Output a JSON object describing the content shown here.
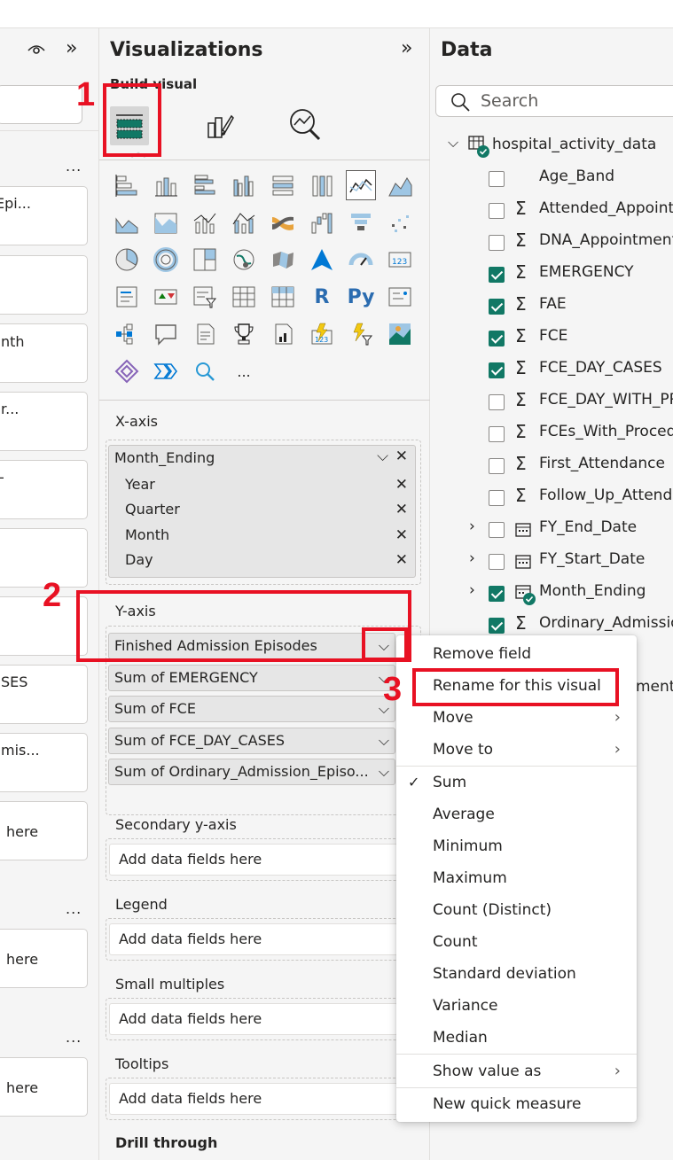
{
  "filters_pane": {
    "cards": [
      {
        "text": "Epi..."
      },
      {
        "text": ""
      },
      {
        "text": "nth"
      },
      {
        "text": "r..."
      },
      {
        "text": "-"
      },
      {
        "text": ""
      },
      {
        "text": ""
      },
      {
        "text": "SES"
      },
      {
        "text": "mis..."
      },
      {
        "text": "here"
      },
      {
        "text": "here"
      },
      {
        "text": "here"
      }
    ],
    "more": "..."
  },
  "visualizations": {
    "title": "Visualizations",
    "build_label": "Build visual",
    "x_axis": {
      "label": "X-axis",
      "field": "Month_Ending",
      "hierarchy": [
        "Year",
        "Quarter",
        "Month",
        "Day"
      ]
    },
    "y_axis": {
      "label": "Y-axis",
      "fields": [
        "Finished Admission Episodes",
        "Sum of EMERGENCY",
        "Sum of FCE",
        "Sum of FCE_DAY_CASES",
        "Sum of Ordinary_Admission_Episo..."
      ]
    },
    "secondary_y": {
      "label": "Secondary y-axis",
      "placeholder": "Add data fields here"
    },
    "legend": {
      "label": "Legend",
      "placeholder": "Add data fields here"
    },
    "small_multiples": {
      "label": "Small multiples",
      "placeholder": "Add data fields here"
    },
    "tooltips": {
      "label": "Tooltips",
      "placeholder": "Add data fields here"
    },
    "drill_through": {
      "label": "Drill through"
    },
    "more": "..."
  },
  "data_pane": {
    "title": "Data",
    "search_placeholder": "Search",
    "table": "hospital_activity_data",
    "fields": [
      {
        "name": "Age_Band",
        "checked": false,
        "sigma": false,
        "type": "text"
      },
      {
        "name": "Attended_Appointm",
        "checked": false,
        "sigma": true,
        "type": "number"
      },
      {
        "name": "DNA_Appointments",
        "checked": false,
        "sigma": true,
        "type": "number"
      },
      {
        "name": "EMERGENCY",
        "checked": true,
        "sigma": true,
        "type": "number"
      },
      {
        "name": "FAE",
        "checked": true,
        "sigma": true,
        "type": "number"
      },
      {
        "name": "FCE",
        "checked": true,
        "sigma": true,
        "type": "number"
      },
      {
        "name": "FCE_DAY_CASES",
        "checked": true,
        "sigma": true,
        "type": "number"
      },
      {
        "name": "FCE_DAY_WITH_PRO",
        "checked": false,
        "sigma": true,
        "type": "number"
      },
      {
        "name": "FCEs_With_Procedu",
        "checked": false,
        "sigma": true,
        "type": "number"
      },
      {
        "name": "First_Attendance",
        "checked": false,
        "sigma": true,
        "type": "number"
      },
      {
        "name": "Follow_Up_Attenda",
        "checked": false,
        "sigma": true,
        "type": "number"
      },
      {
        "name": "FY_End_Date",
        "checked": false,
        "sigma": false,
        "type": "date"
      },
      {
        "name": "FY_Start_Date",
        "checked": false,
        "sigma": false,
        "type": "date"
      },
      {
        "name": "Month_Ending",
        "checked": true,
        "sigma": false,
        "type": "date"
      },
      {
        "name": "Ordinary_Admission",
        "checked": true,
        "sigma": true,
        "type": "number"
      },
      {
        "name": "ment",
        "checked": false,
        "sigma": false,
        "type": "number"
      }
    ]
  },
  "context_menu": {
    "items": [
      "Remove field",
      "Rename for this visual",
      "Move",
      "Move to",
      "Sum",
      "Average",
      "Minimum",
      "Maximum",
      "Count (Distinct)",
      "Count",
      "Standard deviation",
      "Variance",
      "Median",
      "Show value as",
      "New quick measure"
    ],
    "selected_aggregation": "Sum"
  },
  "annotations": {
    "one": "1",
    "two": "2",
    "three": "3"
  },
  "colors": {
    "accent": "#117865",
    "annotation": "#e81123",
    "pane_bg": "#f5f5f5"
  }
}
